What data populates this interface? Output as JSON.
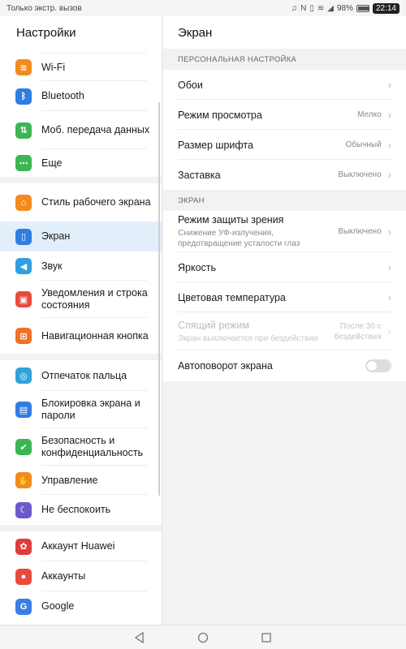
{
  "status_bar": {
    "left_text": "Только экстр. вызов",
    "battery_percent": "98%",
    "time": "22:14"
  },
  "left": {
    "title": "Настройки",
    "groups": [
      [
        {
          "label": "Wi-Fi",
          "icon": "wifi-icon",
          "color": "#f28a1e",
          "glyph": "≋"
        },
        {
          "label": "Bluetooth",
          "icon": "bluetooth-icon",
          "color": "#2f7de1",
          "glyph": "ᛒ"
        },
        {
          "label": "Моб. передача данных",
          "icon": "mobile-data-icon",
          "color": "#3cb554",
          "glyph": "⇅"
        },
        {
          "label": "Еще",
          "icon": "more-icon",
          "color": "#3cb554",
          "glyph": "⋯"
        }
      ],
      [
        {
          "label": "Стиль рабочего экрана",
          "icon": "home-style-icon",
          "color": "#f28a1e",
          "glyph": "⌂"
        },
        {
          "label": "Экран",
          "icon": "display-icon",
          "color": "#2f7de1",
          "glyph": "▯",
          "selected": true
        },
        {
          "label": "Звук",
          "icon": "sound-icon",
          "color": "#2f9fe1",
          "glyph": "◀"
        },
        {
          "label": "Уведомления и строка состояния",
          "icon": "notifications-icon",
          "color": "#e84a3c",
          "glyph": "▣"
        },
        {
          "label": "Навигационная кнопка",
          "icon": "navigation-icon",
          "color": "#f07028",
          "glyph": "⊞"
        }
      ],
      [
        {
          "label": "Отпечаток пальца",
          "icon": "fingerprint-icon",
          "color": "#2fa3d8",
          "glyph": "◎"
        },
        {
          "label": "Блокировка экрана и пароли",
          "icon": "lock-icon",
          "color": "#2f7de1",
          "glyph": "▤"
        },
        {
          "label": "Безопасность и конфиденциальность",
          "icon": "shield-icon",
          "color": "#3cb554",
          "glyph": "✔"
        },
        {
          "label": "Управление",
          "icon": "hand-icon",
          "color": "#f28a1e",
          "glyph": "✋"
        },
        {
          "label": "Не беспокоить",
          "icon": "moon-icon",
          "color": "#6a5acd",
          "glyph": "☾"
        }
      ],
      [
        {
          "label": "Аккаунт Huawei",
          "icon": "huawei-icon",
          "color": "#e03c3c",
          "glyph": "✿"
        },
        {
          "label": "Аккаунты",
          "icon": "accounts-icon",
          "color": "#e84a3c",
          "glyph": "●"
        },
        {
          "label": "Google",
          "icon": "google-icon",
          "color": "#3b7ee8",
          "glyph": "G"
        }
      ]
    ]
  },
  "right": {
    "title": "Экран",
    "sections": [
      {
        "title": "ПЕРСОНАЛЬНАЯ НАСТРОЙКА",
        "rows": [
          {
            "title": "Обои",
            "value": "",
            "type": "chevron"
          },
          {
            "title": "Режим просмотра",
            "value": "Мелко",
            "type": "chevron"
          },
          {
            "title": "Размер шрифта",
            "value": "Обычный",
            "type": "chevron"
          },
          {
            "title": "Заставка",
            "value": "Выключено",
            "type": "chevron"
          }
        ]
      },
      {
        "title": "ЭКРАН",
        "rows": [
          {
            "title": "Режим защиты зрения",
            "sub": "Снижение УФ-излучения, предотвращение усталости глаз",
            "value": "Выключено",
            "type": "chevron"
          },
          {
            "title": "Яркость",
            "value": "",
            "type": "chevron"
          },
          {
            "title": "Цветовая температура",
            "value": "",
            "type": "chevron"
          },
          {
            "title": "Спящий режим",
            "sub": "Экран выключается при бездействии",
            "value": "После 30 с бездействия",
            "type": "chevron",
            "disabled": true
          },
          {
            "title": "Автоповорот экрана",
            "value": "",
            "type": "toggle",
            "on": false
          }
        ]
      }
    ]
  },
  "navbar": {
    "buttons": [
      "back-button",
      "home-button",
      "recents-button"
    ]
  }
}
